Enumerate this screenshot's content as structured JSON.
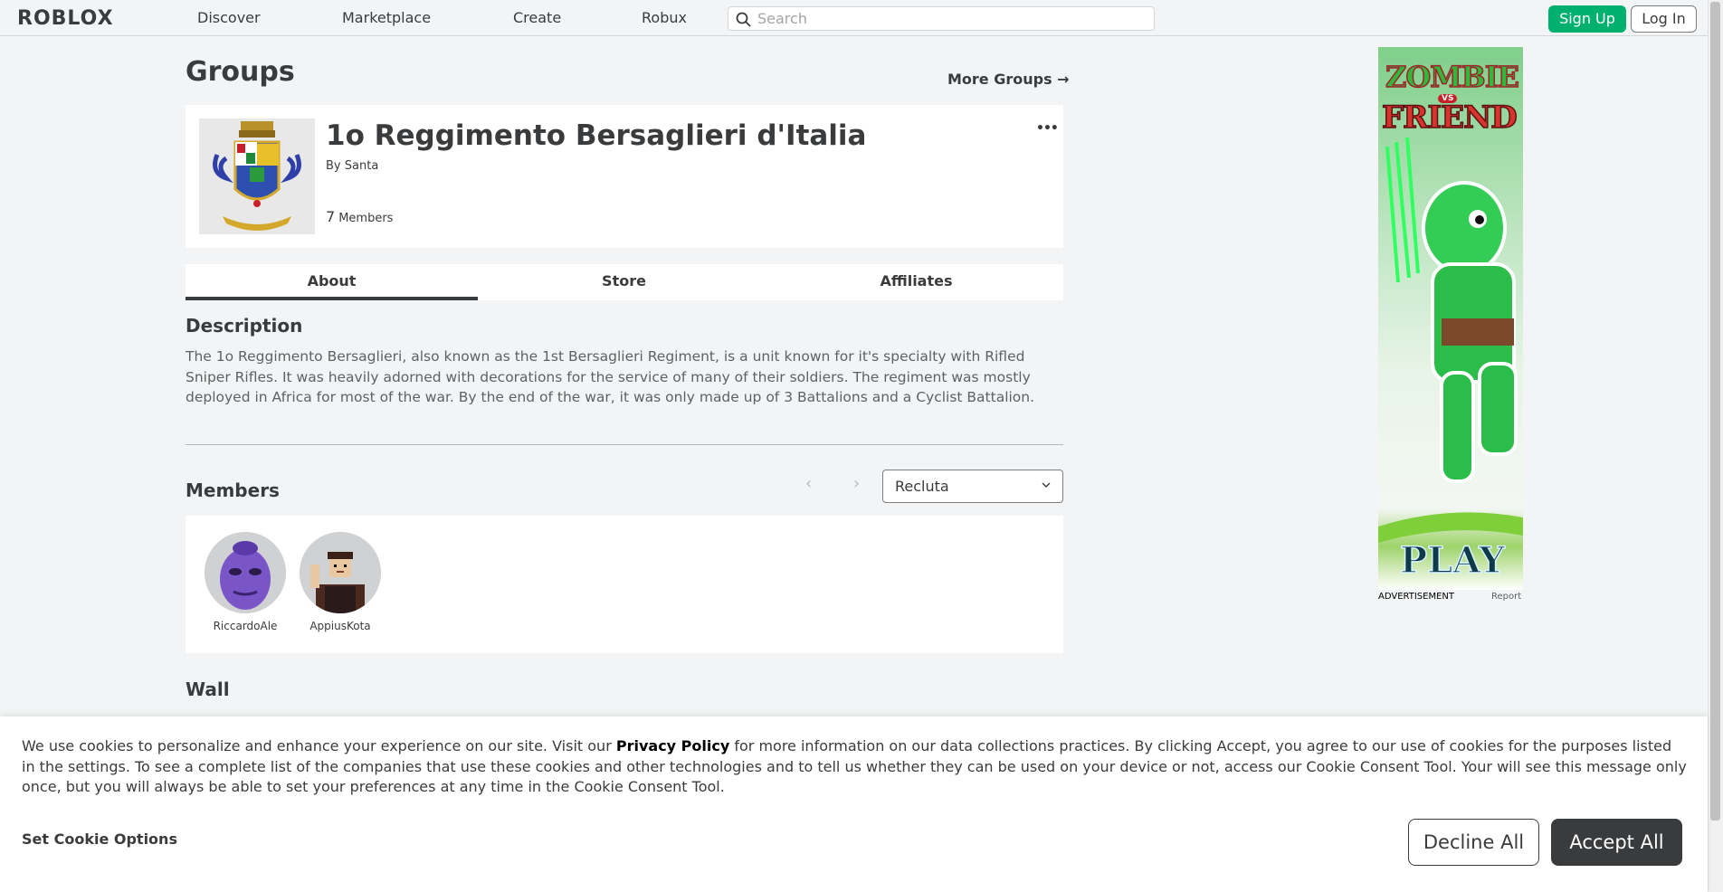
{
  "nav": {
    "logo": "ROBLOX",
    "links": [
      "Discover",
      "Marketplace",
      "Create",
      "Robux"
    ],
    "search_placeholder": "Search",
    "signup_label": "Sign Up",
    "login_label": "Log In"
  },
  "header": {
    "title": "Groups",
    "more_groups": "More Groups →"
  },
  "group": {
    "name": "1o Reggimento Bersaglieri d'Italia",
    "owner_prefix": "By",
    "owner": "Santa",
    "member_count": "7",
    "member_label": "Members",
    "more_menu": "•••"
  },
  "tabs": [
    {
      "label": "About",
      "active": true
    },
    {
      "label": "Store",
      "active": false
    },
    {
      "label": "Affiliates",
      "active": false
    }
  ],
  "description": {
    "title": "Description",
    "text": "The 1o Reggimento Bersaglieri, also known as the 1st Bersaglieri Regiment, is a unit known for it's specialty with Rifled Sniper Rifles. It was heavily adorned with decorations for the service of many of their soldiers. The regiment was mostly deployed in Africa for most of the war. By the end of the war, it was only made up of 3 Battalions and a Cyclist Battalion."
  },
  "members": {
    "title": "Members",
    "role_selected": "Recluta",
    "list": [
      {
        "name": "RiccardoAle"
      },
      {
        "name": "AppiusKota"
      }
    ]
  },
  "ad": {
    "title_line1": "ZOMBIE",
    "vs": "VS",
    "title_line2": "FRIEND",
    "cta": "PLAY",
    "label": "ADVERTISEMENT",
    "report": "Report"
  },
  "wall": {
    "title": "Wall"
  },
  "cookie": {
    "text_before": "We use cookies to personalize and enhance your experience on our site. Visit our ",
    "link": "Privacy Policy",
    "text_after": " for more information on our data collections practices. By clicking Accept, you agree to our use of cookies for the purposes listed in the settings. To see a complete list of the companies that use these cookies and other technologies and to tell us whether they can be used on your device or not, access our Cookie Consent Tool. Your will see this message only once, but you will always be able to set your preferences at any time in the Cookie Consent Tool.",
    "set_options": "Set Cookie Options",
    "decline": "Decline All",
    "accept": "Accept All"
  },
  "colors": {
    "page_bg": "#f2f4f5",
    "signup_green": "#00b06f",
    "text_dark": "#393b3d"
  }
}
